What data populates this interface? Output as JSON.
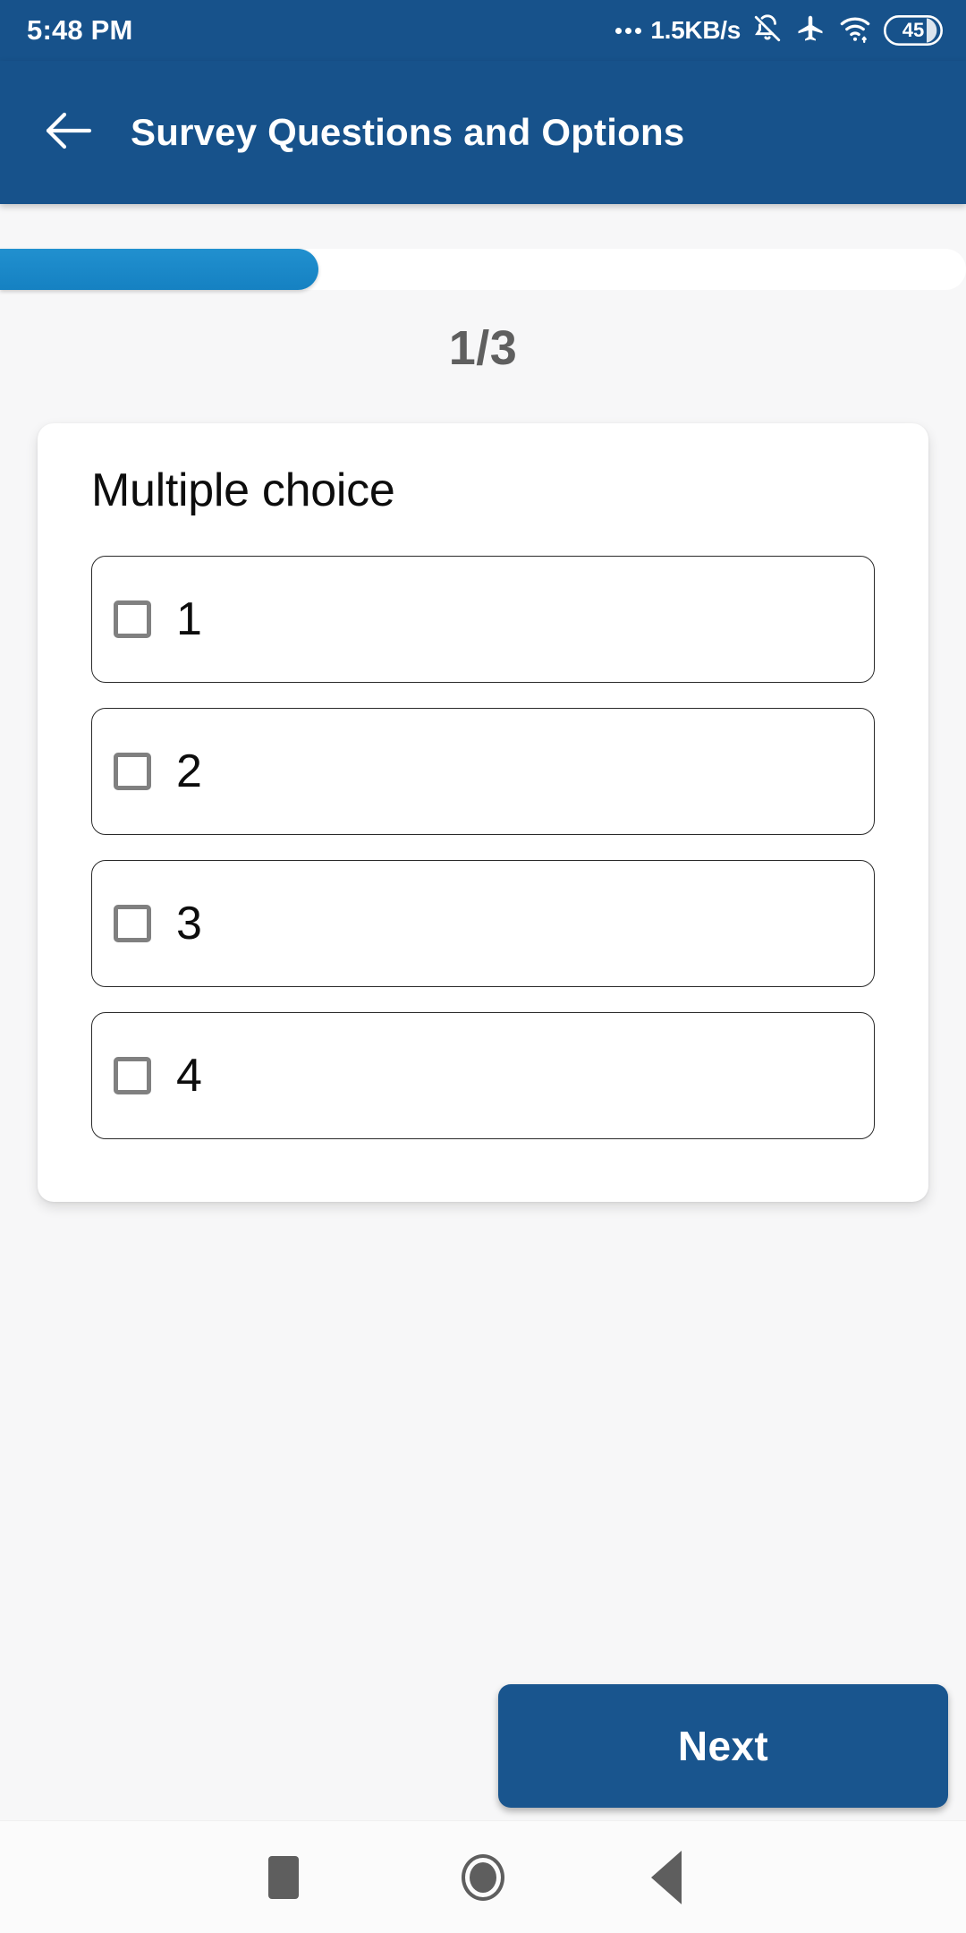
{
  "status_bar": {
    "clock": "5:48 PM",
    "network_speed": "1.5KB/s",
    "icons": [
      "overflow-dots-icon",
      "notifications-muted-icon",
      "airplane-mode-icon",
      "wifi-icon",
      "battery-icon"
    ],
    "battery_level": "45"
  },
  "app_bar": {
    "back_icon": "arrow-left-icon",
    "title": "Survey Questions and Options",
    "background_color": "#17528b"
  },
  "progress": {
    "percent": 33,
    "counter": "1/3",
    "current": 1,
    "total": 3,
    "fill_color": "#1b87c9"
  },
  "question_card": {
    "question": "Multiple choice",
    "options": [
      {
        "label": "1",
        "checked": false
      },
      {
        "label": "2",
        "checked": false
      },
      {
        "label": "3",
        "checked": false
      },
      {
        "label": "4",
        "checked": false
      }
    ]
  },
  "footer": {
    "next_label": "Next",
    "next_color": "#19558e"
  },
  "nav_bar": {
    "recents_icon": "square-icon",
    "home_icon": "circle-icon",
    "back_icon": "triangle-left-icon"
  }
}
